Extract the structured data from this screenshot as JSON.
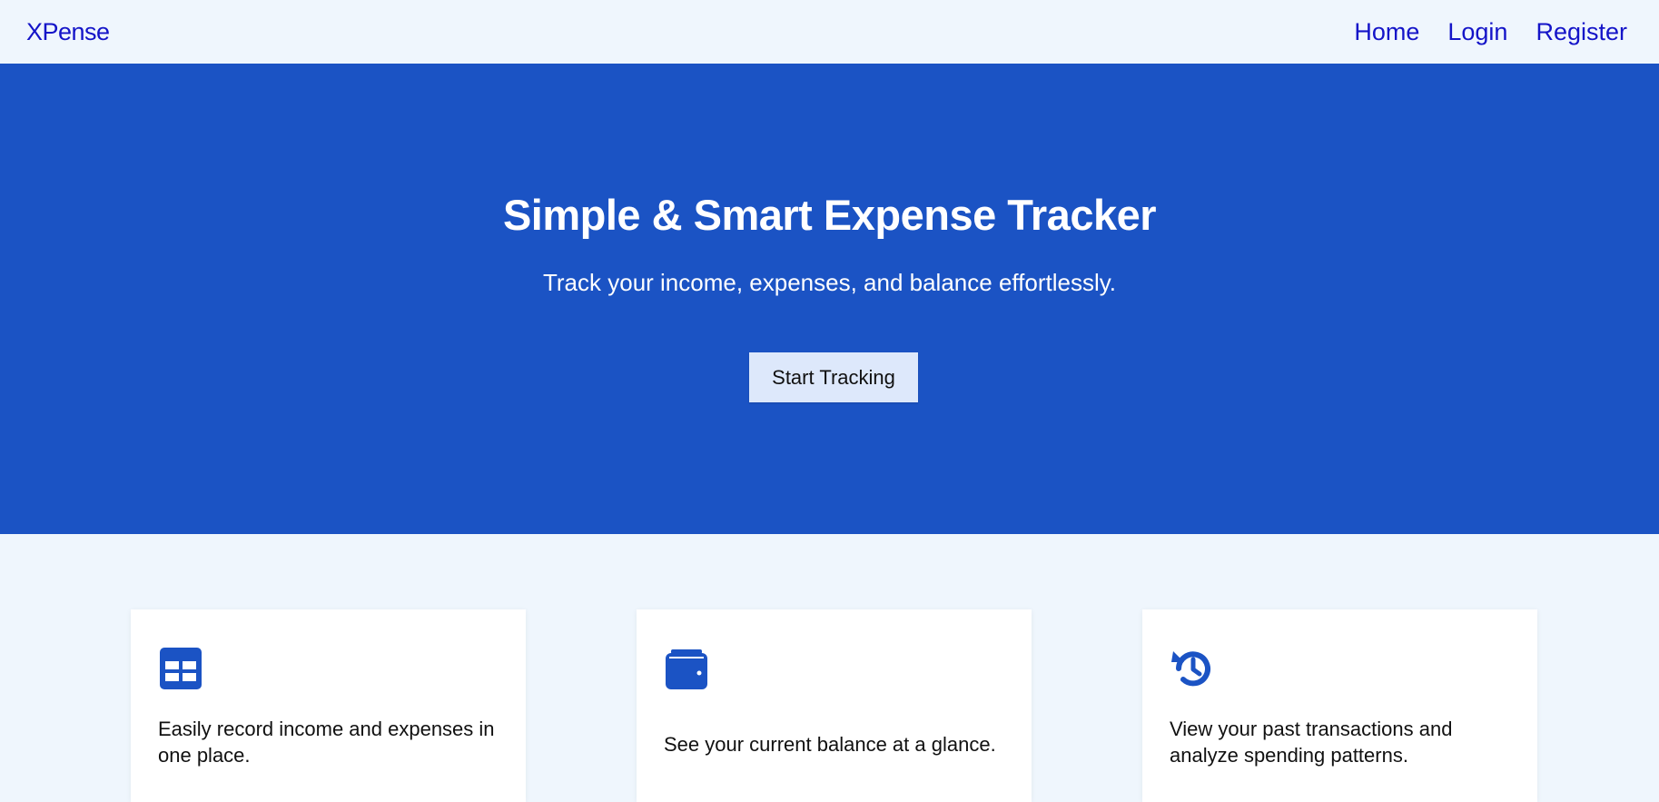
{
  "navbar": {
    "brand": "XPense",
    "links": [
      "Home",
      "Login",
      "Register"
    ]
  },
  "hero": {
    "title": "Simple & Smart Expense Tracker",
    "subtitle": "Track your income, expenses, and balance effortlessly.",
    "cta_label": "Start Tracking"
  },
  "features": [
    {
      "icon": "table-icon",
      "text": "Easily record income and expenses in one place."
    },
    {
      "icon": "wallet-icon",
      "text": "See your current balance at a glance."
    },
    {
      "icon": "history-icon",
      "text": "View your past transactions and analyze spending patterns."
    }
  ],
  "colors": {
    "page_bg": "#eff6fd",
    "hero_bg": "#1b53c4",
    "link": "#1414c8",
    "button_bg": "#dde8fb",
    "icon": "#1b53c4"
  }
}
